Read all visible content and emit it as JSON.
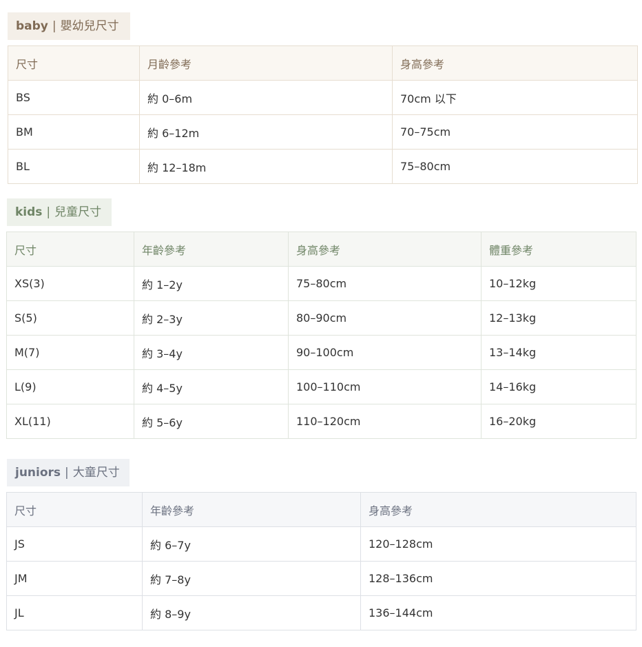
{
  "baby": {
    "tag": {
      "en": "baby",
      "sep": "|",
      "zh": "嬰幼兒尺寸"
    },
    "headers": [
      "尺寸",
      "月齡參考",
      "身高參考"
    ],
    "rows": [
      [
        "BS",
        "約 0–6m",
        "70cm 以下"
      ],
      [
        "BM",
        "約 6–12m",
        "70–75cm"
      ],
      [
        "BL",
        "約 12–18m",
        "75–80cm"
      ]
    ]
  },
  "kids": {
    "tag": {
      "en": "kids",
      "sep": "|",
      "zh": "兒童尺寸"
    },
    "headers": [
      "尺寸",
      "年齡參考",
      "身高參考",
      "體重參考"
    ],
    "rows": [
      [
        "XS(3)",
        "約 1–2y",
        "75–80cm",
        "10–12kg"
      ],
      [
        "S(5)",
        "約 2–3y",
        "80–90cm",
        "12–13kg"
      ],
      [
        "M(7)",
        "約 3–4y",
        "90–100cm",
        "13–14kg"
      ],
      [
        "L(9)",
        "約 4–5y",
        "100–110cm",
        "14–16kg"
      ],
      [
        "XL(11)",
        "約 5–6y",
        "110–120cm",
        "16–20kg"
      ]
    ]
  },
  "juniors": {
    "tag": {
      "en": "juniors",
      "sep": "|",
      "zh": "大童尺寸"
    },
    "headers": [
      "尺寸",
      "年齡參考",
      "身高參考"
    ],
    "rows": [
      [
        "JS",
        "約 6–7y",
        "120–128cm"
      ],
      [
        "JM",
        "約 7–8y",
        "128–136cm"
      ],
      [
        "JL",
        "約 8–9y",
        "136–144cm"
      ]
    ]
  }
}
